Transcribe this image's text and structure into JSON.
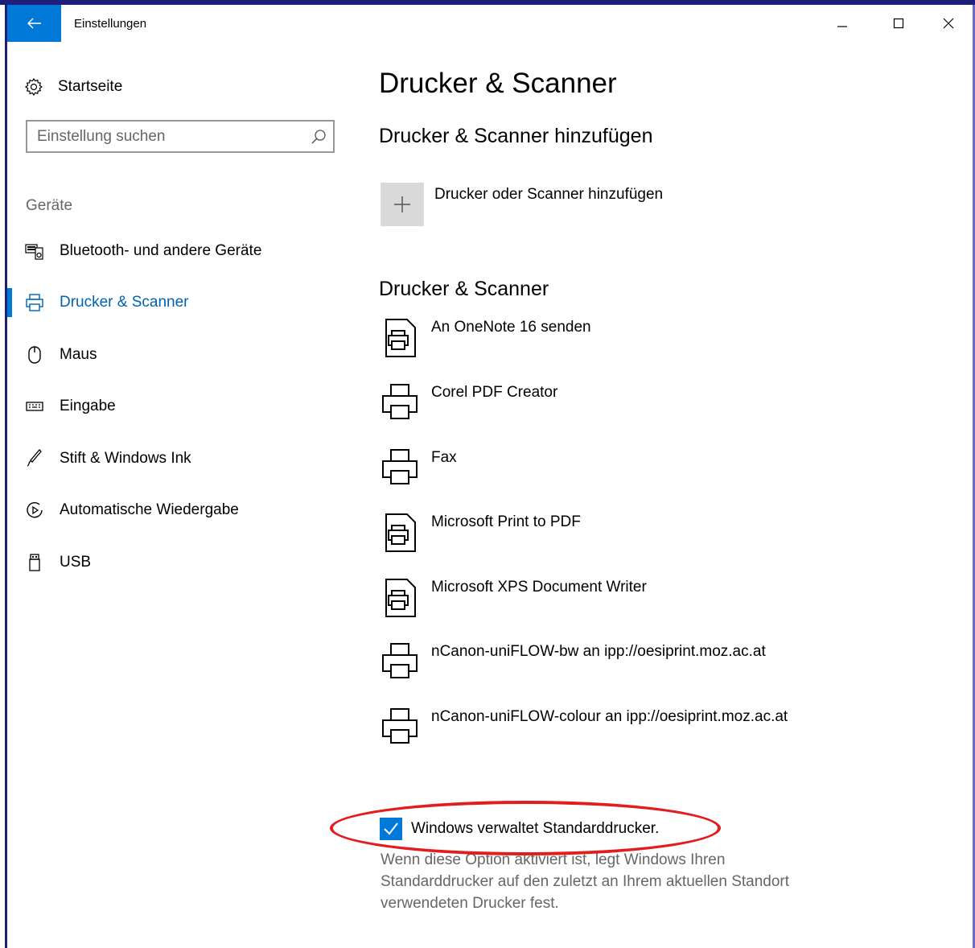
{
  "window": {
    "title": "Einstellungen",
    "back_icon": "arrow-left-icon",
    "controls": [
      "minimize-icon",
      "maximize-icon",
      "close-icon"
    ],
    "accent_color": "#0078d7"
  },
  "sidebar": {
    "home_label": "Startseite",
    "search_placeholder": "Einstellung suchen",
    "section_title": "Geräte",
    "items": [
      {
        "label": "Bluetooth- und andere Geräte",
        "icon": "devices-icon",
        "active": false
      },
      {
        "label": "Drucker & Scanner",
        "icon": "printer-icon",
        "active": true
      },
      {
        "label": "Maus",
        "icon": "mouse-icon",
        "active": false
      },
      {
        "label": "Eingabe",
        "icon": "keyboard-icon",
        "active": false
      },
      {
        "label": "Stift & Windows Ink",
        "icon": "pen-icon",
        "active": false
      },
      {
        "label": "Automatische Wiedergabe",
        "icon": "autoplay-icon",
        "active": false
      },
      {
        "label": "USB",
        "icon": "usb-icon",
        "active": false
      }
    ]
  },
  "main": {
    "title": "Drucker & Scanner",
    "add_section_title": "Drucker & Scanner hinzufügen",
    "add_button_label": "Drucker oder Scanner hinzufügen",
    "list_title": "Drucker & Scanner",
    "printers": [
      {
        "name": "An OneNote 16 senden",
        "icon": "document-printer-icon"
      },
      {
        "name": "Corel PDF Creator",
        "icon": "printer-icon"
      },
      {
        "name": "Fax",
        "icon": "printer-icon"
      },
      {
        "name": "Microsoft Print to PDF",
        "icon": "document-printer-icon"
      },
      {
        "name": "Microsoft XPS Document Writer",
        "icon": "document-printer-icon"
      },
      {
        "name": "nCanon-uniFLOW-bw an ipp://oesiprint.moz.ac.at",
        "icon": "printer-icon"
      },
      {
        "name": "nCanon-uniFLOW-colour an ipp://oesiprint.moz.ac.at",
        "icon": "printer-icon"
      }
    ],
    "default_printer_checkbox": {
      "label": "Windows verwaltet Standarddrucker.",
      "checked": true,
      "description": "Wenn diese Option aktiviert ist, legt Windows Ihren Standarddrucker auf den zuletzt an Ihrem aktuellen Standort verwendeten Drucker fest."
    },
    "highlight_color": "#e31d1d"
  }
}
